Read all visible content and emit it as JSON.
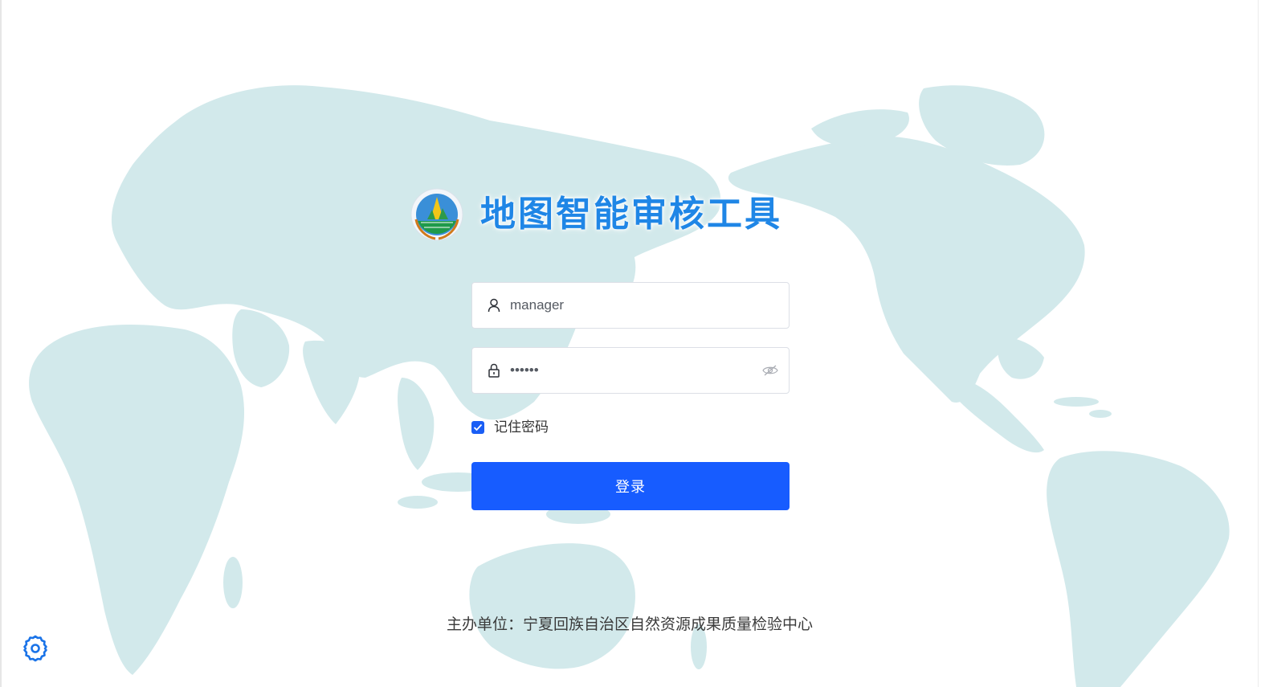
{
  "app": {
    "title": "地图智能审核工具"
  },
  "login_form": {
    "username": {
      "value": "manager",
      "icon": "user-icon"
    },
    "password": {
      "value": "••••••",
      "icon": "lock-icon",
      "toggle_icon": "eye-hidden-icon"
    },
    "remember": {
      "label": "记住密码",
      "checked": true
    },
    "submit_label": "登录"
  },
  "footer": {
    "text": "主办单位：宁夏回族自治区自然资源成果质量检验中心"
  },
  "settings": {
    "icon": "gear-icon"
  },
  "colors": {
    "accent": "#175cff",
    "title": "#1f86e6",
    "map_land": "#d2e9eb"
  }
}
